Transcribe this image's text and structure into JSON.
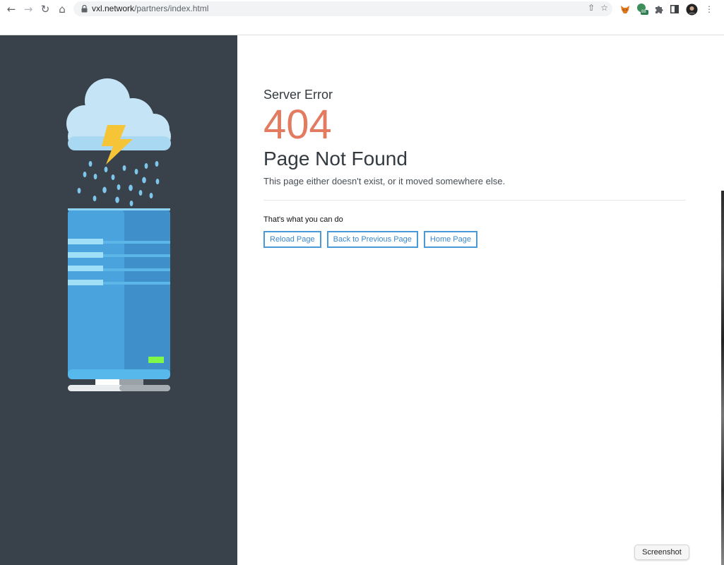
{
  "browser": {
    "url_host": "vxl.network",
    "url_path": "/partners/index.html",
    "back_icon": "arrow-left-icon",
    "forward_icon": "arrow-right-icon",
    "reload_icon": "reload-icon",
    "home_icon": "home-icon",
    "extension_badge": "88"
  },
  "error": {
    "subtitle": "Server Error",
    "code": "404",
    "title": "Page Not Found",
    "description": "This page either doesn't exist, or it moved somewhere else.",
    "actions_heading": "That's what you can do",
    "buttons": {
      "reload": "Reload Page",
      "back": "Back to Previous Page",
      "home": "Home Page"
    }
  },
  "overlay": {
    "screenshot_label": "Screenshot"
  },
  "colors": {
    "left_panel": "#39424b",
    "error_code": "#e27b5f",
    "button_border": "#4a9ad7"
  }
}
